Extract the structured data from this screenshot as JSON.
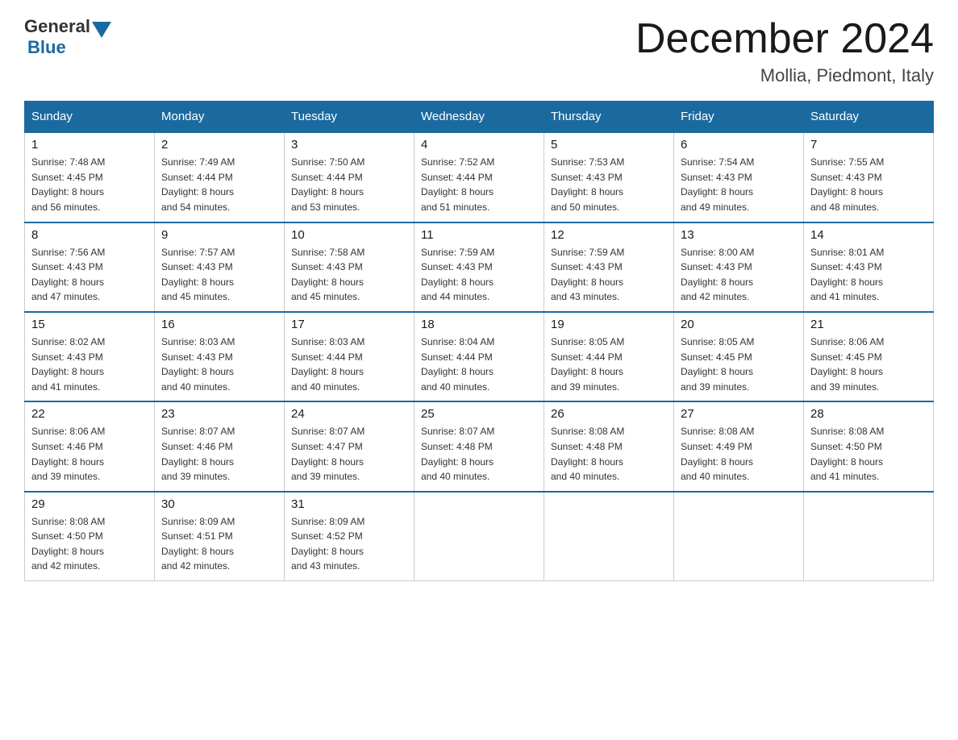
{
  "header": {
    "logo_general": "General",
    "logo_blue": "Blue",
    "month_title": "December 2024",
    "location": "Mollia, Piedmont, Italy"
  },
  "days_of_week": [
    "Sunday",
    "Monday",
    "Tuesday",
    "Wednesday",
    "Thursday",
    "Friday",
    "Saturday"
  ],
  "weeks": [
    [
      {
        "num": "1",
        "sunrise": "7:48 AM",
        "sunset": "4:45 PM",
        "daylight": "8 hours and 56 minutes."
      },
      {
        "num": "2",
        "sunrise": "7:49 AM",
        "sunset": "4:44 PM",
        "daylight": "8 hours and 54 minutes."
      },
      {
        "num": "3",
        "sunrise": "7:50 AM",
        "sunset": "4:44 PM",
        "daylight": "8 hours and 53 minutes."
      },
      {
        "num": "4",
        "sunrise": "7:52 AM",
        "sunset": "4:44 PM",
        "daylight": "8 hours and 51 minutes."
      },
      {
        "num": "5",
        "sunrise": "7:53 AM",
        "sunset": "4:43 PM",
        "daylight": "8 hours and 50 minutes."
      },
      {
        "num": "6",
        "sunrise": "7:54 AM",
        "sunset": "4:43 PM",
        "daylight": "8 hours and 49 minutes."
      },
      {
        "num": "7",
        "sunrise": "7:55 AM",
        "sunset": "4:43 PM",
        "daylight": "8 hours and 48 minutes."
      }
    ],
    [
      {
        "num": "8",
        "sunrise": "7:56 AM",
        "sunset": "4:43 PM",
        "daylight": "8 hours and 47 minutes."
      },
      {
        "num": "9",
        "sunrise": "7:57 AM",
        "sunset": "4:43 PM",
        "daylight": "8 hours and 45 minutes."
      },
      {
        "num": "10",
        "sunrise": "7:58 AM",
        "sunset": "4:43 PM",
        "daylight": "8 hours and 45 minutes."
      },
      {
        "num": "11",
        "sunrise": "7:59 AM",
        "sunset": "4:43 PM",
        "daylight": "8 hours and 44 minutes."
      },
      {
        "num": "12",
        "sunrise": "7:59 AM",
        "sunset": "4:43 PM",
        "daylight": "8 hours and 43 minutes."
      },
      {
        "num": "13",
        "sunrise": "8:00 AM",
        "sunset": "4:43 PM",
        "daylight": "8 hours and 42 minutes."
      },
      {
        "num": "14",
        "sunrise": "8:01 AM",
        "sunset": "4:43 PM",
        "daylight": "8 hours and 41 minutes."
      }
    ],
    [
      {
        "num": "15",
        "sunrise": "8:02 AM",
        "sunset": "4:43 PM",
        "daylight": "8 hours and 41 minutes."
      },
      {
        "num": "16",
        "sunrise": "8:03 AM",
        "sunset": "4:43 PM",
        "daylight": "8 hours and 40 minutes."
      },
      {
        "num": "17",
        "sunrise": "8:03 AM",
        "sunset": "4:44 PM",
        "daylight": "8 hours and 40 minutes."
      },
      {
        "num": "18",
        "sunrise": "8:04 AM",
        "sunset": "4:44 PM",
        "daylight": "8 hours and 40 minutes."
      },
      {
        "num": "19",
        "sunrise": "8:05 AM",
        "sunset": "4:44 PM",
        "daylight": "8 hours and 39 minutes."
      },
      {
        "num": "20",
        "sunrise": "8:05 AM",
        "sunset": "4:45 PM",
        "daylight": "8 hours and 39 minutes."
      },
      {
        "num": "21",
        "sunrise": "8:06 AM",
        "sunset": "4:45 PM",
        "daylight": "8 hours and 39 minutes."
      }
    ],
    [
      {
        "num": "22",
        "sunrise": "8:06 AM",
        "sunset": "4:46 PM",
        "daylight": "8 hours and 39 minutes."
      },
      {
        "num": "23",
        "sunrise": "8:07 AM",
        "sunset": "4:46 PM",
        "daylight": "8 hours and 39 minutes."
      },
      {
        "num": "24",
        "sunrise": "8:07 AM",
        "sunset": "4:47 PM",
        "daylight": "8 hours and 39 minutes."
      },
      {
        "num": "25",
        "sunrise": "8:07 AM",
        "sunset": "4:48 PM",
        "daylight": "8 hours and 40 minutes."
      },
      {
        "num": "26",
        "sunrise": "8:08 AM",
        "sunset": "4:48 PM",
        "daylight": "8 hours and 40 minutes."
      },
      {
        "num": "27",
        "sunrise": "8:08 AM",
        "sunset": "4:49 PM",
        "daylight": "8 hours and 40 minutes."
      },
      {
        "num": "28",
        "sunrise": "8:08 AM",
        "sunset": "4:50 PM",
        "daylight": "8 hours and 41 minutes."
      }
    ],
    [
      {
        "num": "29",
        "sunrise": "8:08 AM",
        "sunset": "4:50 PM",
        "daylight": "8 hours and 42 minutes."
      },
      {
        "num": "30",
        "sunrise": "8:09 AM",
        "sunset": "4:51 PM",
        "daylight": "8 hours and 42 minutes."
      },
      {
        "num": "31",
        "sunrise": "8:09 AM",
        "sunset": "4:52 PM",
        "daylight": "8 hours and 43 minutes."
      },
      null,
      null,
      null,
      null
    ]
  ],
  "labels": {
    "sunrise_prefix": "Sunrise: ",
    "sunset_prefix": "Sunset: ",
    "daylight_prefix": "Daylight: "
  }
}
